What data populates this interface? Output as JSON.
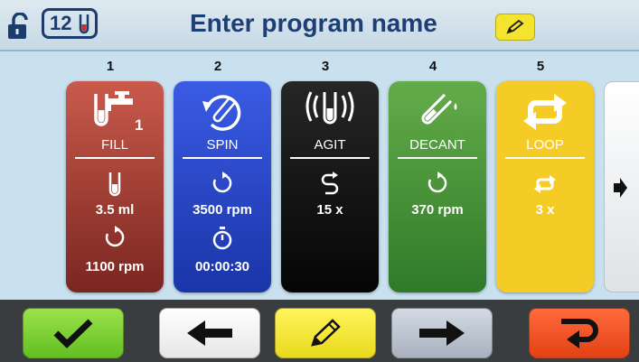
{
  "header": {
    "tube_count": "12",
    "title": "Enter program name",
    "icons": {
      "lock": "unlock-icon",
      "tube": "tube-icon",
      "edit": "pencil-icon"
    }
  },
  "steps": [
    {
      "number": "1",
      "label": "FILL",
      "icon": "fill-tap-icon",
      "badge": "1",
      "value1": "3.5 ml",
      "value1_icon": "tube-icon",
      "value2": "1100 rpm",
      "value2_icon": "rotate-icon",
      "color": "#a13a30"
    },
    {
      "number": "2",
      "label": "SPIN",
      "icon": "spin-icon",
      "value1": "3500 rpm",
      "value1_icon": "rotate-icon",
      "value2": "00:00:30",
      "value2_icon": "timer-icon",
      "color": "#2a47c8"
    },
    {
      "number": "3",
      "label": "AGIT",
      "icon": "agitate-icon",
      "value1": "15 x",
      "value1_icon": "agitate-cycle-icon",
      "color": "#111111"
    },
    {
      "number": "4",
      "label": "DECANT",
      "icon": "decant-icon",
      "value1": "370 rpm",
      "value1_icon": "rotate-icon",
      "color": "#47923a"
    },
    {
      "number": "5",
      "label": "LOOP",
      "icon": "loop-icon",
      "value1": "3 x",
      "value1_icon": "loop-icon",
      "color": "#f5cc26"
    }
  ],
  "footer": {
    "buttons": [
      {
        "name": "confirm",
        "icon": "checkmark-icon"
      },
      {
        "name": "previous",
        "icon": "arrow-left-icon"
      },
      {
        "name": "edit",
        "icon": "pencil-icon"
      },
      {
        "name": "next",
        "icon": "arrow-right-icon"
      },
      {
        "name": "return",
        "icon": "return-arrow-icon"
      }
    ]
  }
}
